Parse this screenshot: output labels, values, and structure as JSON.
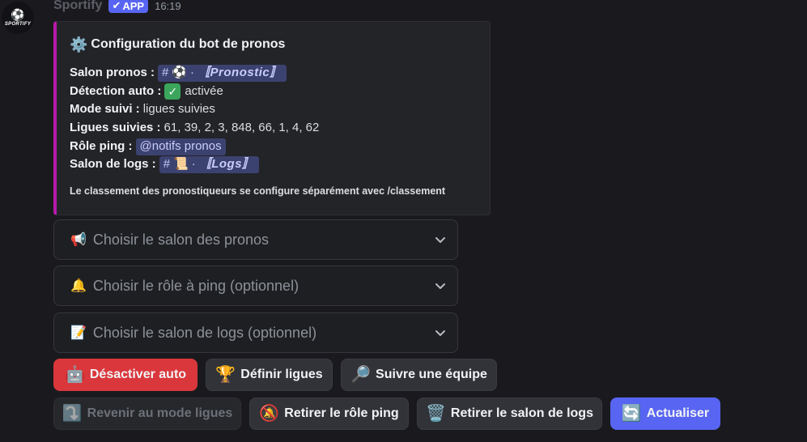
{
  "message": {
    "username": "Sportify",
    "avatar_text": "SPORTIFY",
    "app_badge": "APP",
    "timestamp": "16:19"
  },
  "embed": {
    "title": "Configuration du bot de pronos",
    "accent_color": "#b61ba9",
    "fields": {
      "salon_pronos_label": "Salon pronos :",
      "salon_pronos_value": "〚Pronostic〛",
      "detection_label": "Détection auto :",
      "detection_value": "activée",
      "mode_label": "Mode suivi :",
      "mode_value": "ligues suivies",
      "ligues_label": "Ligues suivies :",
      "ligues_value": "61, 39, 2, 3, 848, 66, 1, 4, 62",
      "role_label": "Rôle ping :",
      "role_value": "@notifs pronos",
      "logs_label": "Salon de logs :",
      "logs_value": "〚Logs〛"
    },
    "footer": "Le classement des pronostiqueurs se configure séparément avec /classement"
  },
  "selects": [
    {
      "icon": "📢",
      "placeholder": "Choisir le salon des pronos"
    },
    {
      "icon": "🔔",
      "placeholder": "Choisir le rôle à ping (optionnel)"
    },
    {
      "icon": "📝",
      "placeholder": "Choisir le salon de logs (optionnel)"
    }
  ],
  "buttons": {
    "desactiver": {
      "icon": "🤖",
      "label": "Désactiver auto"
    },
    "definir": {
      "icon": "🏆",
      "label": "Définir ligues"
    },
    "suivre": {
      "icon": "🔎",
      "label": "Suivre une équipe"
    },
    "revenir": {
      "icon": "⤵️",
      "label": "Revenir au mode ligues"
    },
    "retirer_role": {
      "icon": "🔕",
      "label": "Retirer le rôle ping"
    },
    "retirer_logs": {
      "icon": "🗑️",
      "label": "Retirer le salon de logs"
    },
    "actualiser": {
      "icon": "🔄",
      "label": "Actualiser"
    }
  },
  "colors": {
    "danger": "#da373c",
    "primary": "#5865f2",
    "mention_bg": "#3c4270"
  }
}
